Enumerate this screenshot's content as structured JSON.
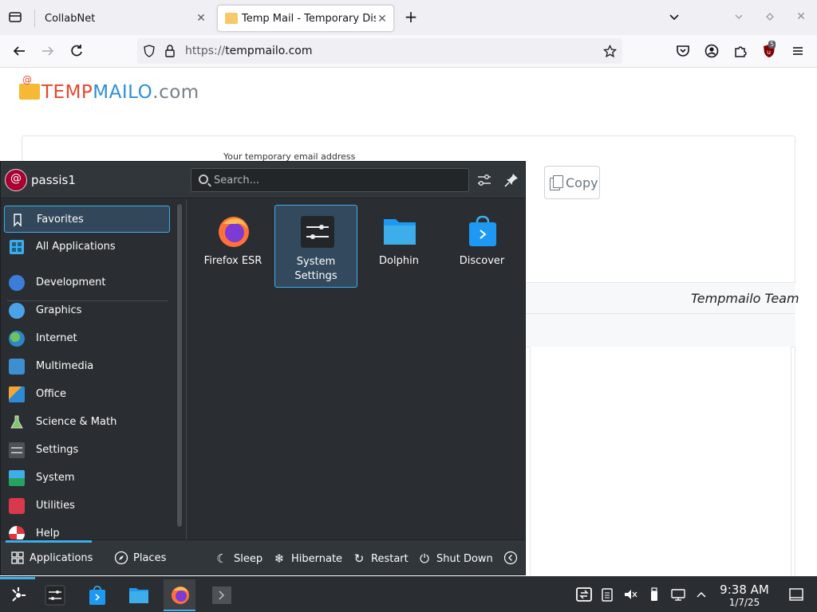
{
  "browser": {
    "tabs": [
      {
        "title": "CollabNet"
      },
      {
        "title": "Temp Mail - Temporary Disposable Email"
      }
    ],
    "url": {
      "scheme": "https://",
      "host": "tempmailo.com"
    },
    "extension_badge": "5"
  },
  "page": {
    "logo": {
      "part1": "TEMP",
      "part2": "MAILO",
      "part3": ".com"
    },
    "address_label": "Your temporary email address",
    "copy_label": "Copy",
    "inbox_signature": "Tempmailo Team"
  },
  "launcher": {
    "username": "passis1",
    "search_placeholder": "Search...",
    "categories": [
      {
        "label": "Favorites",
        "icon": "bookmark-icon"
      },
      {
        "label": "All Applications",
        "icon": "grid-icon"
      },
      {
        "label": "Development",
        "icon": "development-icon"
      },
      {
        "label": "Graphics",
        "icon": "graphics-icon"
      },
      {
        "label": "Internet",
        "icon": "internet-globe-icon"
      },
      {
        "label": "Multimedia",
        "icon": "multimedia-icon"
      },
      {
        "label": "Office",
        "icon": "office-icon"
      },
      {
        "label": "Science & Math",
        "icon": "science-flask-icon"
      },
      {
        "label": "Settings",
        "icon": "settings-sliders-icon"
      },
      {
        "label": "System",
        "icon": "system-icon"
      },
      {
        "label": "Utilities",
        "icon": "utilities-toolbox-icon"
      },
      {
        "label": "Help",
        "icon": "help-lifebuoy-icon"
      }
    ],
    "favorites": [
      {
        "label": "Firefox ESR",
        "icon": "firefox-icon"
      },
      {
        "label": "System Settings",
        "icon": "system-settings-icon"
      },
      {
        "label": "Dolphin",
        "icon": "dolphin-folder-icon"
      },
      {
        "label": "Discover",
        "icon": "discover-bag-icon"
      }
    ],
    "footer": {
      "applications": "Applications",
      "places": "Places",
      "sleep": "Sleep",
      "hibernate": "Hibernate",
      "restart": "Restart",
      "shutdown": "Shut Down"
    }
  },
  "taskbar": {
    "time": "9:38 AM",
    "date": "1/7/25"
  },
  "colors": {
    "accent": "#3daee9",
    "panel_bg": "#2a2e32",
    "logo_red": "#e8472d",
    "logo_blue": "#2e8fd6"
  }
}
